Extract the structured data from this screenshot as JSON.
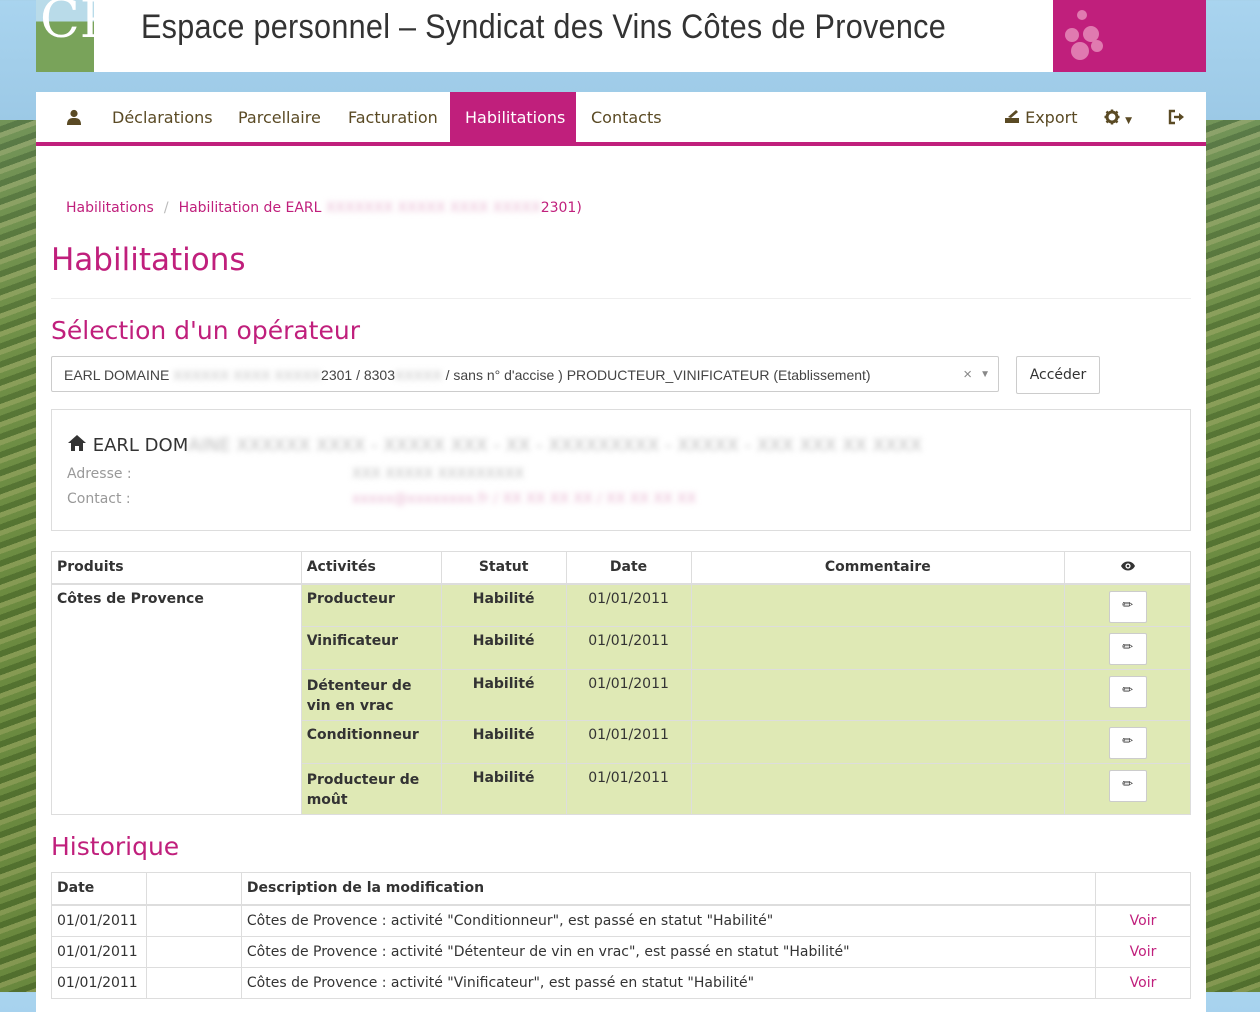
{
  "header": {
    "title": "Espace personnel – Syndicat des Vins Côtes de Provence",
    "logo_text": "CP"
  },
  "nav": {
    "items": [
      {
        "label": "Déclarations"
      },
      {
        "label": "Parcellaire"
      },
      {
        "label": "Facturation"
      },
      {
        "label": "Habilitations",
        "active": true
      },
      {
        "label": "Contacts"
      }
    ],
    "export_label": "Export",
    "icons": [
      "user-icon",
      "export-icon",
      "gear-icon",
      "logout-icon"
    ]
  },
  "breadcrumb": {
    "root": "Habilitations",
    "current_prefix": "Habilitation de EARL",
    "current_suffix": "2301)"
  },
  "page_title": "Habilitations",
  "operator_section": {
    "title": "Sélection d'un opérateur",
    "select_prefix": "EARL DOMAINE",
    "select_mid": "2301 / 8303",
    "select_suffix": "/ sans n° d'accise ) PRODUCTEUR_VINIFICATEUR (Etablissement)",
    "select_clear": "×",
    "select_arrow": "▼",
    "button_label": "Accéder"
  },
  "operator_panel": {
    "name_prefix": "EARL DOM",
    "address_label": "Adresse :",
    "contact_label": "Contact :"
  },
  "habilitations_table": {
    "headers": [
      "Produits",
      "Activités",
      "Statut",
      "Date",
      "Commentaire"
    ],
    "product": "Côtes de Provence",
    "rows": [
      {
        "activity": "Producteur",
        "status": "Habilité",
        "date": "01/01/2011",
        "comment": ""
      },
      {
        "activity": "Vinificateur",
        "status": "Habilité",
        "date": "01/01/2011",
        "comment": ""
      },
      {
        "activity": "Détenteur de vin en vrac",
        "status": "Habilité",
        "date": "01/01/2011",
        "comment": ""
      },
      {
        "activity": "Conditionneur",
        "status": "Habilité",
        "date": "01/01/2011",
        "comment": ""
      },
      {
        "activity": "Producteur de moût",
        "status": "Habilité",
        "date": "01/01/2011",
        "comment": ""
      }
    ]
  },
  "history": {
    "title": "Historique",
    "headers": [
      "Date",
      "",
      "Description de la modification",
      ""
    ],
    "rows": [
      {
        "date": "01/01/2011",
        "description": "Côtes de Provence : activité \"Conditionneur\", est passé en statut \"Habilité\"",
        "link": "Voir"
      },
      {
        "date": "01/01/2011",
        "description": "Côtes de Provence : activité \"Détenteur de vin en vrac\", est passé en statut \"Habilité\"",
        "link": "Voir"
      },
      {
        "date": "01/01/2011",
        "description": "Côtes de Provence : activité \"Vinificateur\", est passé en statut \"Habilité\"",
        "link": "Voir"
      }
    ]
  },
  "colors": {
    "accent": "#c01f7c",
    "habilite_row": "#dfe9b5"
  }
}
